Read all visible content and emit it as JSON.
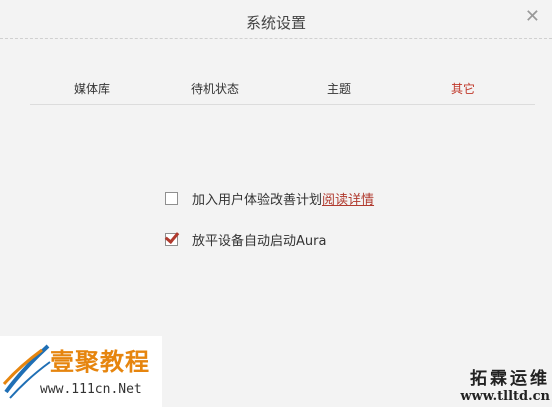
{
  "window": {
    "title": "系统设置",
    "close_label": "✕"
  },
  "tabs": [
    {
      "label": "媒体库",
      "active": false
    },
    {
      "label": "待机状态",
      "active": false
    },
    {
      "label": "主题",
      "active": false
    },
    {
      "label": "其它",
      "active": true
    }
  ],
  "options": {
    "experience_program": {
      "label": "加入用户体验改善计划",
      "link_label": "阅读详情",
      "checked": false
    },
    "auto_start": {
      "label": "放平设备自动启动Aura",
      "checked": true
    }
  },
  "watermarks": {
    "left_logo": "壹聚教程",
    "left_url": "www.111cn.Net",
    "right_logo": "拓霖运维",
    "right_url": "www.tlltd.cn"
  },
  "colors": {
    "accent": "#b03a2e",
    "background": "#f3f3f3"
  }
}
